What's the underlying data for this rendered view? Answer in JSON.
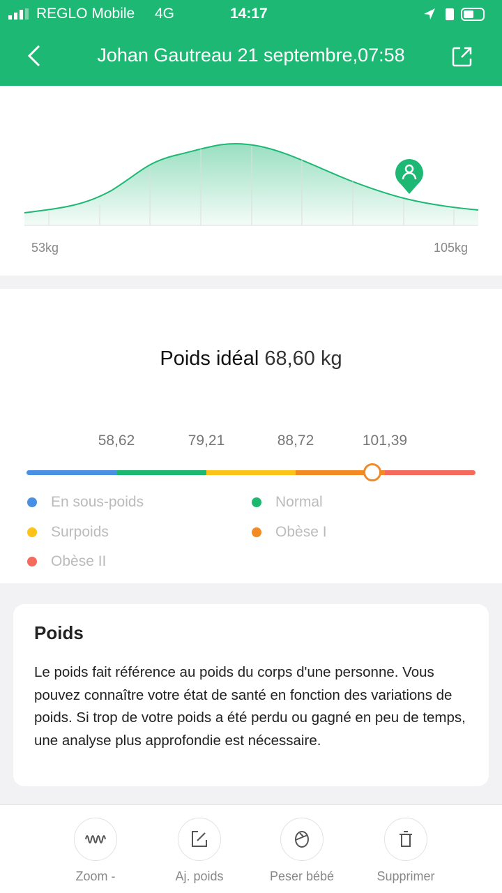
{
  "status_bar": {
    "carrier": "REGLO Mobile",
    "network": "4G",
    "time": "14:17"
  },
  "header": {
    "title": "Johan Gautreau 21 septembre,07:58",
    "back_icon": "chevron-left-icon",
    "share_icon": "share-icon"
  },
  "distribution": {
    "min_label": "53kg",
    "max_label": "105kg",
    "marker_icon": "user-pin-icon"
  },
  "ideal": {
    "label": "Poids idéal",
    "value": "68,60",
    "unit": "kg"
  },
  "scale": {
    "thresholds": [
      "58,62",
      "79,21",
      "88,72",
      "101,39"
    ],
    "marker_fraction": 0.77,
    "categories": [
      {
        "label": "En sous-poids",
        "color": "#4a90e2"
      },
      {
        "label": "Normal",
        "color": "#1db870"
      },
      {
        "label": "Surpoids",
        "color": "#fcc419"
      },
      {
        "label": "Obèse I",
        "color": "#f38b24"
      },
      {
        "label": "Obèse II",
        "color": "#f46a5c"
      }
    ]
  },
  "info": {
    "title": "Poids",
    "text": "Le poids fait référence au poids du corps d'une personne. Vous pouvez connaître votre état de santé en fonction des variations de poids. Si trop de votre poids a été perdu ou gagné en peu de temps, une analyse plus approfondie est nécessaire."
  },
  "toolbar": [
    {
      "label": "Zoom -",
      "icon": "wave-icon"
    },
    {
      "label": "Aj. poids",
      "icon": "edit-icon"
    },
    {
      "label": "Peser bébé",
      "icon": "baby-icon"
    },
    {
      "label": "Supprimer",
      "icon": "trash-icon"
    }
  ]
}
